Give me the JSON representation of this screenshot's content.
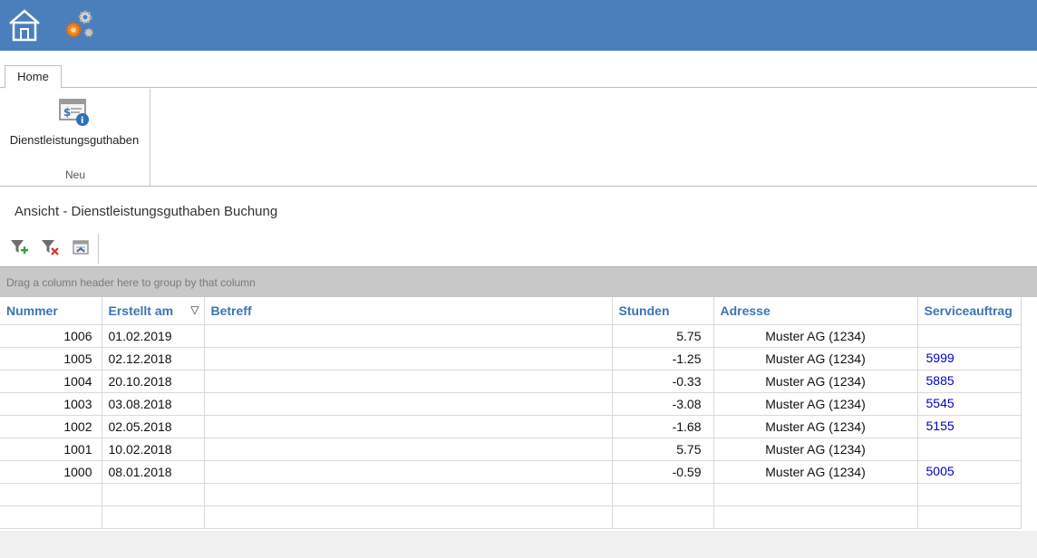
{
  "topbar": {
    "home_icon": "home-icon",
    "settings_icon": "gears-icon"
  },
  "ribbon": {
    "tabs": [
      {
        "label": "Home"
      }
    ],
    "button": {
      "label": "Dienstleistungsguthaben",
      "icon": "credit-info-icon"
    },
    "group_label": "Neu"
  },
  "view": {
    "title": "Ansicht - Dienstleistungsguthaben Buchung",
    "toolbar": [
      {
        "name": "add-filter-icon"
      },
      {
        "name": "remove-filter-icon"
      },
      {
        "name": "export-icon"
      }
    ],
    "group_hint": "Drag a column header here to group by that column"
  },
  "grid": {
    "columns": [
      "Nummer",
      "Erstellt am",
      "Betreff",
      "Stunden",
      "Adresse",
      "Serviceauftrag"
    ],
    "sort_indicator": "▽",
    "rows": [
      {
        "nummer": "1006",
        "erstellt": "01.02.2019",
        "betreff": "",
        "stunden": "5.75",
        "adresse": "Muster AG (1234)",
        "auftrag": ""
      },
      {
        "nummer": "1005",
        "erstellt": "02.12.2018",
        "betreff": "",
        "stunden": "-1.25",
        "adresse": "Muster AG (1234)",
        "auftrag": "5999"
      },
      {
        "nummer": "1004",
        "erstellt": "20.10.2018",
        "betreff": "",
        "stunden": "-0.33",
        "adresse": "Muster AG (1234)",
        "auftrag": "5885"
      },
      {
        "nummer": "1003",
        "erstellt": "03.08.2018",
        "betreff": "",
        "stunden": "-3.08",
        "adresse": "Muster AG (1234)",
        "auftrag": "5545"
      },
      {
        "nummer": "1002",
        "erstellt": "02.05.2018",
        "betreff": "",
        "stunden": "-1.68",
        "adresse": "Muster AG (1234)",
        "auftrag": "5155"
      },
      {
        "nummer": "1001",
        "erstellt": "10.02.2018",
        "betreff": "",
        "stunden": "5.75",
        "adresse": "Muster AG (1234)",
        "auftrag": ""
      },
      {
        "nummer": "1000",
        "erstellt": "08.01.2018",
        "betreff": "",
        "stunden": "-0.59",
        "adresse": "Muster AG (1234)",
        "auftrag": "5005"
      }
    ]
  },
  "colors": {
    "header_blue": "#4a7fbb",
    "column_header": "#3e73b9",
    "link": "#0000cc"
  }
}
